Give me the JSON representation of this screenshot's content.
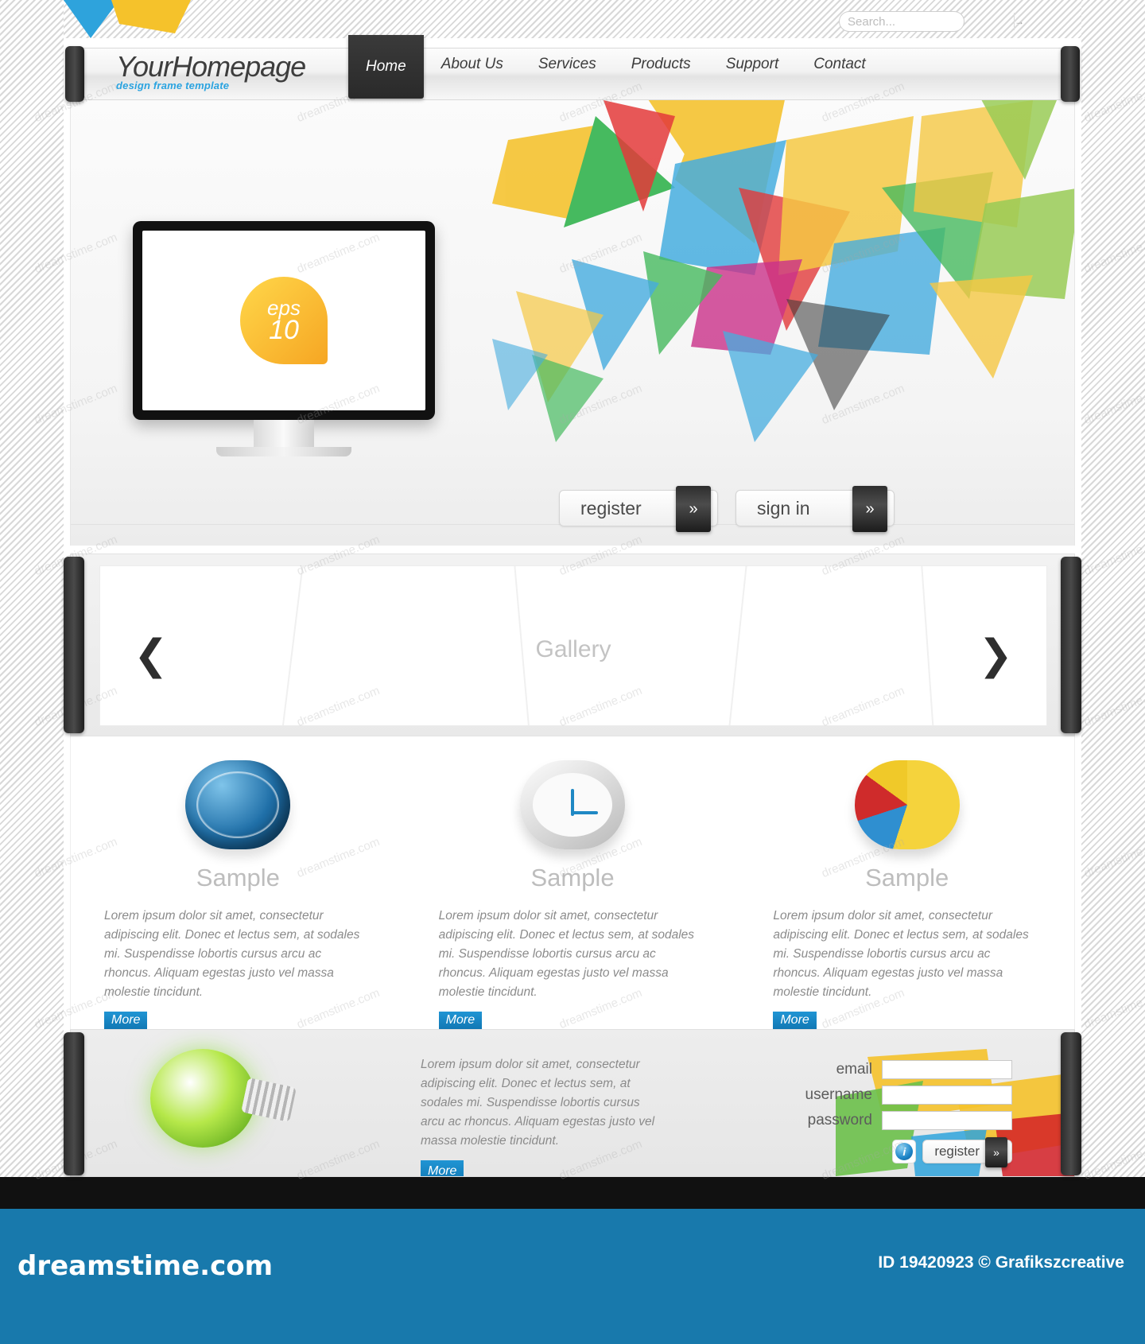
{
  "search": {
    "placeholder": "Search...",
    "value": "",
    "go_icon": "arrow-right-icon"
  },
  "brand": {
    "name": "YourHomepage",
    "tagline": "design frame template"
  },
  "nav": {
    "items": [
      {
        "label": "Home",
        "active": true
      },
      {
        "label": "About Us",
        "active": false
      },
      {
        "label": "Services",
        "active": false
      },
      {
        "label": "Products",
        "active": false
      },
      {
        "label": "Support",
        "active": false
      },
      {
        "label": "Contact",
        "active": false
      }
    ]
  },
  "hero": {
    "screen_badge_top": "eps",
    "screen_badge_bottom": "10",
    "register_label": "register",
    "register_icon": "double-chevron-up-icon",
    "signin_label": "sign in",
    "signin_icon": "double-chevron-right-icon"
  },
  "gallery": {
    "label": "Gallery",
    "prev_icon": "chevron-left-icon",
    "next_icon": "chevron-right-icon"
  },
  "cards": [
    {
      "icon": "globe-icon",
      "title": "Sample",
      "text": "Lorem ipsum dolor sit amet, consectetur adipiscing elit. Donec et lectus sem, at sodales mi. Suspendisse lobortis cursus arcu ac rhoncus. Aliquam egestas justo vel massa molestie tincidunt.",
      "more_label": "More"
    },
    {
      "icon": "clock-icon",
      "title": "Sample",
      "text": "Lorem ipsum dolor sit amet, consectetur adipiscing elit. Donec et lectus sem, at sodales mi. Suspendisse lobortis cursus arcu ac rhoncus. Aliquam egestas justo vel massa molestie tincidunt.",
      "more_label": "More"
    },
    {
      "icon": "pie-chart-icon",
      "title": "Sample",
      "text": "Lorem ipsum dolor sit amet, consectetur adipiscing elit. Donec et lectus sem, at sodales mi. Suspendisse lobortis cursus arcu ac rhoncus. Aliquam egestas justo vel massa molestie tincidunt.",
      "more_label": "More"
    }
  ],
  "footer_band": {
    "icon": "lightbulb-icon",
    "text": "Lorem ipsum dolor sit amet, consectetur adipiscing elit. Donec et lectus sem, at sodales mi. Suspendisse lobortis cursus arcu ac rhoncus. Aliquam egestas justo vel massa molestie tincidunt.",
    "more_label": "More",
    "form": {
      "email_label": "email",
      "email_value": "",
      "username_label": "username",
      "username_value": "",
      "password_label": "password",
      "password_value": "",
      "info_icon": "info-icon",
      "info_glyph": "i",
      "register_label": "register",
      "register_icon": "double-chevron-up-icon"
    }
  },
  "watermark": {
    "site": "dreamstime.com",
    "credit": "ID 19420923 © Grafikszcreative",
    "tile": "dreamstime.com"
  },
  "colors": {
    "accent_blue": "#1879ac",
    "more_blue": "#1178b4",
    "tagline_blue": "#2aa3e0",
    "dark_tab": "#2c2c2c"
  }
}
